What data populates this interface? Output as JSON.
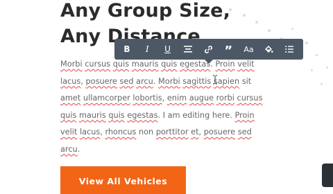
{
  "heading": {
    "line1": "Any Group Size,",
    "line2": "Any Distance"
  },
  "paragraph": [
    {
      "t": "Morbi",
      "s": true
    },
    {
      "t": " "
    },
    {
      "t": "cursus",
      "s": true
    },
    {
      "t": " "
    },
    {
      "t": "quis",
      "s": true
    },
    {
      "t": " "
    },
    {
      "t": "mauris",
      "s": true
    },
    {
      "t": " "
    },
    {
      "t": "quis",
      "s": true
    },
    {
      "t": " "
    },
    {
      "t": "egestas",
      "s": true
    },
    {
      "t": ". "
    },
    {
      "t": "Proin",
      "s": true
    },
    {
      "t": " "
    },
    {
      "t": "velit",
      "s": true
    },
    {
      "t": " "
    },
    {
      "t": "lacus",
      "s": true
    },
    {
      "t": ", "
    },
    {
      "t": "posuere",
      "s": true
    },
    {
      "t": " "
    },
    {
      "t": "sed",
      "s": true
    },
    {
      "t": " "
    },
    {
      "t": "arcu",
      "s": true
    },
    {
      "t": ". "
    },
    {
      "t": "Morbi",
      "s": true
    },
    {
      "t": " "
    },
    {
      "t": "sagittis",
      "s": true
    },
    {
      "t": " "
    },
    {
      "t": "sapien",
      "s": true
    },
    {
      "t": " sit "
    },
    {
      "t": "amet",
      "s": true
    },
    {
      "t": " "
    },
    {
      "t": "ullamcorper",
      "s": true
    },
    {
      "t": " "
    },
    {
      "t": "lobortis",
      "s": true
    },
    {
      "t": ", "
    },
    {
      "t": "enim",
      "s": true
    },
    {
      "t": " "
    },
    {
      "t": "augue",
      "s": true
    },
    {
      "t": " "
    },
    {
      "t": "rorbi",
      "s": true
    },
    {
      "t": " "
    },
    {
      "t": "cursus",
      "s": true
    },
    {
      "t": " "
    },
    {
      "t": "quis",
      "s": true
    },
    {
      "t": " "
    },
    {
      "t": "mauris",
      "s": true
    },
    {
      "t": " "
    },
    {
      "t": "quis",
      "s": true
    },
    {
      "t": " "
    },
    {
      "t": "egestas",
      "s": true
    },
    {
      "t": ". I am editing "
    },
    {
      "t": "here. "
    },
    {
      "t": "Proin",
      "s": true
    },
    {
      "t": " "
    },
    {
      "t": "velit",
      "s": true
    },
    {
      "t": " "
    },
    {
      "t": "lacus",
      "s": true
    },
    {
      "t": ", "
    },
    {
      "t": "rhoncus",
      "s": true
    },
    {
      "t": " non "
    },
    {
      "t": "porttitor",
      "s": true
    },
    {
      "t": " "
    },
    {
      "t": "et",
      "s": true
    },
    {
      "t": ", "
    },
    {
      "t": "posuere",
      "s": true
    },
    {
      "t": " "
    },
    {
      "t": "sed",
      "s": true
    },
    {
      "t": " "
    },
    {
      "t": "arcu",
      "s": true
    },
    {
      "t": "."
    }
  ],
  "toolbar": {
    "buttons": [
      {
        "name": "bold-button",
        "label": "B",
        "icon": "bold-icon"
      },
      {
        "name": "italic-button",
        "label": "I",
        "icon": "italic-icon"
      },
      {
        "name": "underline-button",
        "label": "U",
        "icon": "underline-icon"
      },
      {
        "name": "align-button",
        "label": "",
        "icon": "align-icon"
      },
      {
        "name": "link-button",
        "label": "",
        "icon": "link-icon"
      },
      {
        "name": "quote-button",
        "label": "”",
        "icon": "quote-icon"
      },
      {
        "name": "font-size-button",
        "label": "Aa",
        "icon": "font-size-icon"
      },
      {
        "name": "text-color-button",
        "label": "",
        "icon": "paint-bucket-icon"
      },
      {
        "name": "list-button",
        "label": "",
        "icon": "list-icon"
      }
    ]
  },
  "cta": {
    "label": "View All Vehicles"
  },
  "colors": {
    "accent": "#f26516",
    "toolbar": "#4c5866",
    "spellcheck": "#e04545",
    "heading": "#2b2b2b",
    "text": "#666666"
  }
}
